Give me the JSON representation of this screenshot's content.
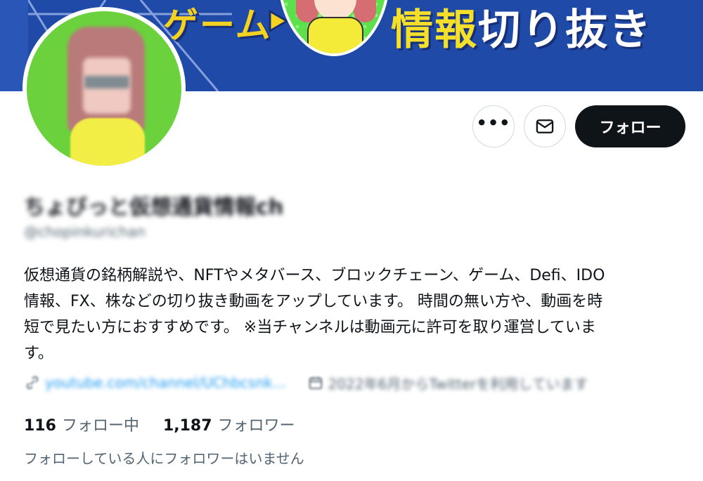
{
  "banner": {
    "title_left": "ゲーム",
    "title_right_yellow": "情報",
    "title_right_white": "切り抜き",
    "colors": {
      "background": "#1f4aa8",
      "accent": "#f4e02a"
    }
  },
  "actions": {
    "more_icon": "more-icon",
    "more_glyph": "•••",
    "message_icon": "envelope-icon",
    "follow_label": "フォロー"
  },
  "profile": {
    "display_name": "ちょびっと仮想通貨情報ch",
    "handle": "@chopinkurichan",
    "bio": "仮想通貨の銘柄解説や、NFTやメタバース、ブロックチェーン、ゲーム、Defi、IDO\n情報、FX、株などの切り抜き動画をアップしています。 時間の無い方や、動画を時\n短で見たい方におすすめです。 ※当チャンネルは動画元に許可を取り運営していま\nす。",
    "link": "youtube.com/channel/UChbcsnk...",
    "link_icon": "link-icon",
    "joined": "2022年6月からTwitterを利用しています",
    "joined_icon": "calendar-icon"
  },
  "stats": {
    "following_count": "116",
    "following_label": "フォロー中",
    "followers_count": "1,187",
    "followers_label": "フォロワー"
  },
  "followed_by_text": "フォローしている人にフォロワーはいません"
}
